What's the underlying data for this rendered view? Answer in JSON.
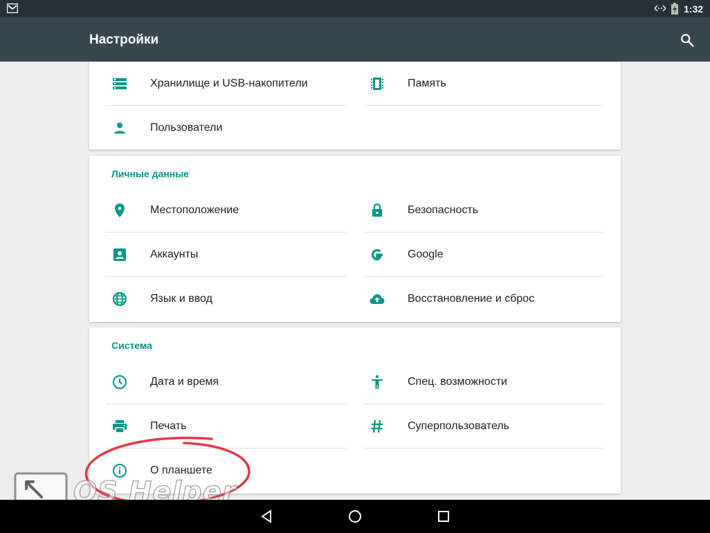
{
  "status_bar": {
    "time": "1:32",
    "icons": [
      "gmail-icon",
      "data-transfer-icon",
      "battery-charging-icon"
    ]
  },
  "app_bar": {
    "title": "Настройки",
    "search_icon": "search-icon"
  },
  "sections": {
    "device": {
      "items": [
        {
          "label": "Хранилище и USB-накопители",
          "icon": "storage-icon"
        },
        {
          "label": "Память",
          "icon": "memory-icon"
        },
        {
          "label": "Пользователи",
          "icon": "person-icon"
        }
      ]
    },
    "personal": {
      "title": "Личные данные",
      "items": [
        {
          "label": "Местоположение",
          "icon": "location-icon"
        },
        {
          "label": "Безопасность",
          "icon": "lock-icon"
        },
        {
          "label": "Аккаунты",
          "icon": "account-box-icon"
        },
        {
          "label": "Google",
          "icon": "google-icon"
        },
        {
          "label": "Язык и ввод",
          "icon": "globe-icon"
        },
        {
          "label": "Восстановление и сброс",
          "icon": "cloud-upload-icon"
        }
      ]
    },
    "system": {
      "title": "Система",
      "items": [
        {
          "label": "Дата и время",
          "icon": "clock-icon"
        },
        {
          "label": "Спец. возможности",
          "icon": "accessibility-icon"
        },
        {
          "label": "Печать",
          "icon": "printer-icon"
        },
        {
          "label": "Суперпользователь",
          "icon": "hash-icon"
        },
        {
          "label": "О планшете",
          "icon": "info-icon"
        }
      ]
    }
  },
  "watermark": {
    "text": "OS Helper"
  },
  "colors": {
    "accent": "#009688",
    "app_bar": "#37474f",
    "status_bar": "#263238",
    "annotation": "#e53945"
  },
  "nav_bar": {
    "buttons": [
      "back-icon",
      "home-icon",
      "recents-icon"
    ]
  }
}
